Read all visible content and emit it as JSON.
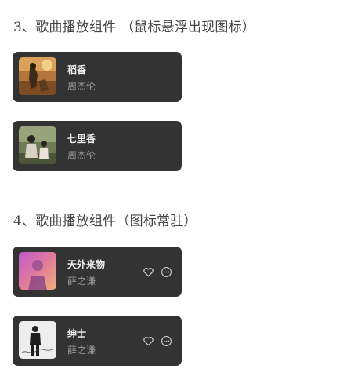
{
  "sections": [
    {
      "title": "3、歌曲播放组件 （鼠标悬浮出现图标）",
      "songs": [
        {
          "title": "稻香",
          "artist": "周杰伦"
        },
        {
          "title": "七里香",
          "artist": "周杰伦"
        }
      ]
    },
    {
      "title": "4、歌曲播放组件（图标常驻）",
      "songs": [
        {
          "title": "天外来物",
          "artist": "薛之谦",
          "icons": [
            "heart-icon",
            "more-icon"
          ]
        },
        {
          "title": "绅士",
          "artist": "薛之谦",
          "icons": [
            "heart-icon",
            "more-icon"
          ]
        }
      ]
    }
  ],
  "colors": {
    "card_bg": "#333333",
    "title_text": "#f2f2f2",
    "artist_text": "#9a9a9a",
    "icon": "#cfcfcf",
    "heading_text": "#444444"
  }
}
